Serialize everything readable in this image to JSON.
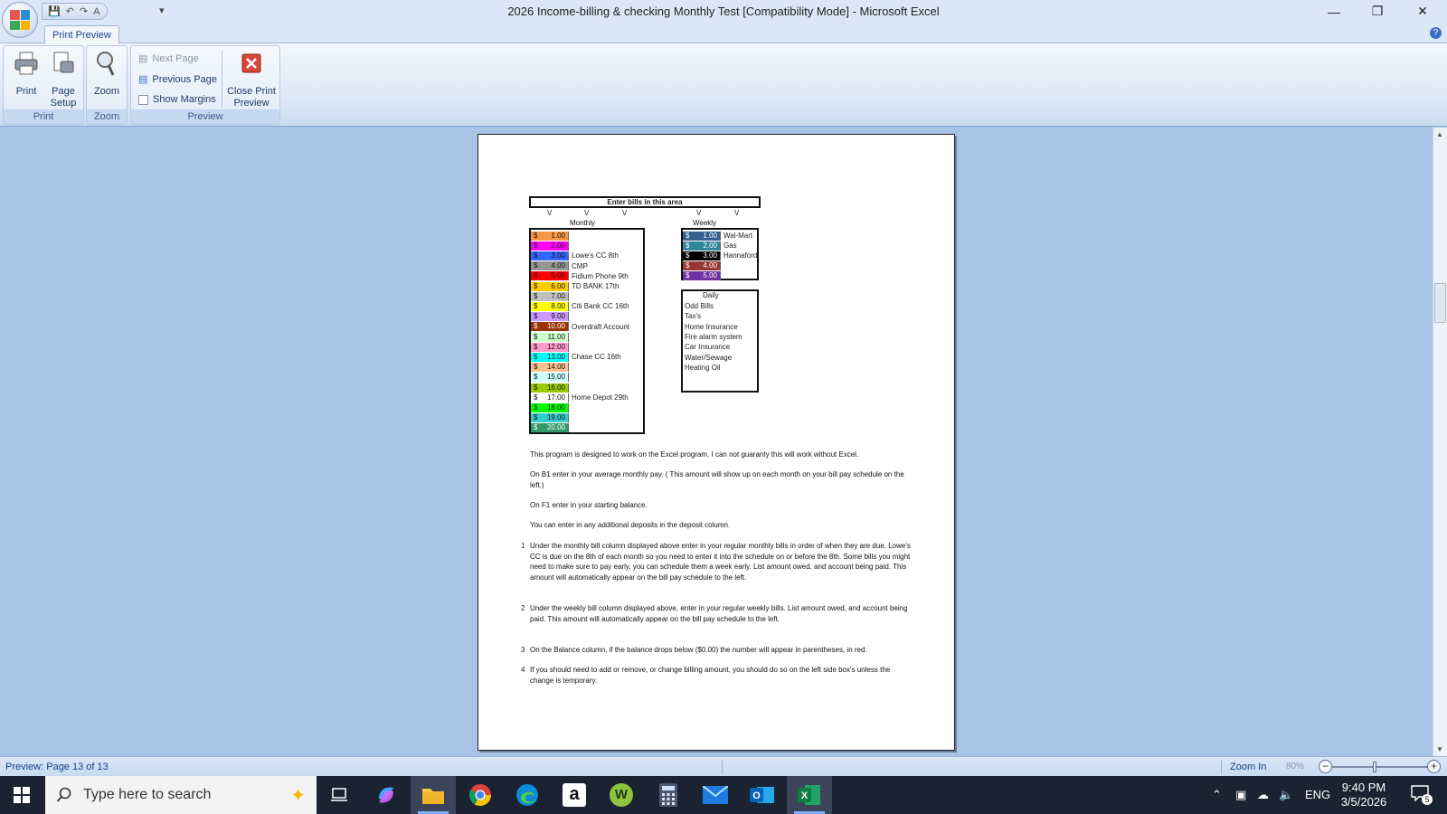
{
  "window": {
    "title": "2026 Income-billing & checking Monthly Test  [Compatibility Mode] - Microsoft Excel",
    "controls": {
      "minimize": "—",
      "restore": "❐",
      "close": "✕"
    }
  },
  "qat": {
    "save": "💾",
    "undo": "↶",
    "redo": "↷",
    "font": "A",
    "more": "▾"
  },
  "ribbon": {
    "tab": "Print Preview",
    "groups": {
      "print": {
        "label": "Print",
        "print_label": "Print",
        "setup_label_1": "Page",
        "setup_label_2": "Setup"
      },
      "zoom": {
        "label": "Zoom",
        "zoom_label": "Zoom"
      },
      "preview": {
        "label": "Preview",
        "next_page": "Next Page",
        "previous_page": "Previous Page",
        "show_margins": "Show Margins",
        "close_1": "Close Print",
        "close_2": "Preview"
      }
    }
  },
  "sheet": {
    "header": "Enter bills in this area",
    "v_marks": [
      "V",
      "V",
      "V",
      "V",
      "V"
    ],
    "monthly_label": "Monthly",
    "weekly_label": "Weekly",
    "daily_label": "Daily",
    "monthly_rows": [
      {
        "cur": "$",
        "amount": "1.00",
        "label": "",
        "color": "#f79646"
      },
      {
        "cur": "$",
        "amount": "2.00",
        "label": "",
        "color": "#ff00ff"
      },
      {
        "cur": "$",
        "amount": "3.00",
        "label": "Lowe's CC 8th",
        "color": "#3366ff"
      },
      {
        "cur": "$",
        "amount": "4.00",
        "label": "CMP",
        "color": "#969696"
      },
      {
        "cur": "$",
        "amount": "5.00",
        "label": "Fidium Phone 9th",
        "color": "#ff0000"
      },
      {
        "cur": "$",
        "amount": "6.00",
        "label": "TD BANK 17th",
        "color": "#ffcc00"
      },
      {
        "cur": "$",
        "amount": "7.00",
        "label": "",
        "color": "#c0c0c0"
      },
      {
        "cur": "$",
        "amount": "8.00",
        "label": "Citi Bank CC 16th",
        "color": "#ffff00"
      },
      {
        "cur": "$",
        "amount": "9.00",
        "label": "",
        "color": "#cc99ff"
      },
      {
        "cur": "$",
        "amount": "10.00",
        "label": "Overdraft Account",
        "color": "#993300"
      },
      {
        "cur": "$",
        "amount": "11.00",
        "label": "",
        "color": "#ccffcc"
      },
      {
        "cur": "$",
        "amount": "12.00",
        "label": "",
        "color": "#ff99cc"
      },
      {
        "cur": "$",
        "amount": "13.00",
        "label": "Chase CC 16th",
        "color": "#00ffff"
      },
      {
        "cur": "$",
        "amount": "14.00",
        "label": "",
        "color": "#fac090"
      },
      {
        "cur": "$",
        "amount": "15.00",
        "label": "",
        "color": "#ccffff"
      },
      {
        "cur": "$",
        "amount": "16.00",
        "label": "",
        "color": "#99cc00"
      },
      {
        "cur": "$",
        "amount": "17.00",
        "label": "Home Depot 29th",
        "color": "#ffffff"
      },
      {
        "cur": "$",
        "amount": "18.00",
        "label": "",
        "color": "#00ff00"
      },
      {
        "cur": "$",
        "amount": "19.00",
        "label": "",
        "color": "#33cccc"
      },
      {
        "cur": "$",
        "amount": "20.00",
        "label": "",
        "color": "#339966"
      }
    ],
    "weekly_rows": [
      {
        "cur": "$",
        "amount": "1.00",
        "label": "Wal-Mart",
        "color": "#376091"
      },
      {
        "cur": "$",
        "amount": "2.00",
        "label": "Gas",
        "color": "#31859b"
      },
      {
        "cur": "$",
        "amount": "3.00",
        "label": "Hannaford",
        "color": "#000000"
      },
      {
        "cur": "$",
        "amount": "4.00",
        "label": "",
        "color": "#953735"
      },
      {
        "cur": "$",
        "amount": "5.00",
        "label": "",
        "color": "#7030a0"
      }
    ],
    "daily_rows": [
      "Odd Bills",
      "Tax's",
      "Home Insurance",
      "Fire alarm system",
      "Car Insurance",
      "Water/Sewage",
      "Heating Oil"
    ],
    "instructions": {
      "p1": "This program is designed to work on the Excel program. I can not guaranty this will work without Excel.",
      "p2": "On B1 enter in your average monthly pay. ( This amount will show up on each month on your bill pay schedule on the left.)",
      "p3": "On F1 enter in your starting balance.",
      "p4": "You can enter in any additional deposits in the deposit column.",
      "n1": "1",
      "i1": "Under the monthly bill column displayed above enter in your regular monthly bills in order of when they are due. Lowe's CC is due on the 8th of each month so you need to enter it into the schedule on or before the 8th. Some bills you might need to make sure to pay early, you can schedule them a week early. List amount owed, and account being paid. This amount will automatically appear on the bill pay schedule to the left.",
      "n2": "2",
      "i2": "Under the weekly bill column displayed above, enter in your regular weekly bills. List amount owed, and account being paid. This amount will automatically appear on the bill pay schedule to the left.",
      "n3": "3",
      "i3": "On the Balance column, if the balance drops below ($0.00) the number will appear in parentheses, in red.",
      "n4": "4",
      "i4": "If you should need to add or remove, or change billing amount, you should do so on the left side box's unless the change is temporary."
    }
  },
  "status": {
    "text": "Preview: Page 13 of 13",
    "zoom_in": "Zoom In",
    "zoom_pct": "80%",
    "minus": "−",
    "plus": "+"
  },
  "taskbar": {
    "search_placeholder": "Type here to search",
    "lang": "ENG",
    "time": "9:40 PM",
    "date": "3/5/2026",
    "notif_count": "5",
    "apps": [
      "task-view",
      "copilot",
      "file-explorer",
      "chrome",
      "edge",
      "amazon",
      "word-game",
      "calculator",
      "mail",
      "outlook",
      "excel"
    ]
  }
}
